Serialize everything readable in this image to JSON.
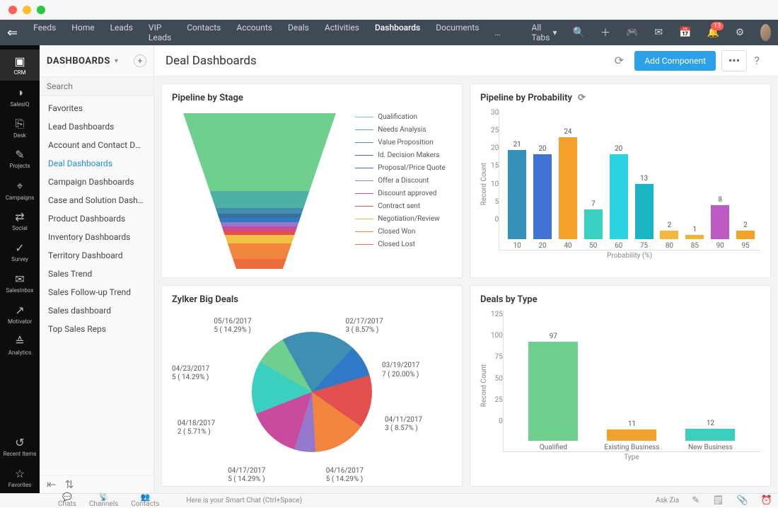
{
  "macDots": true,
  "topnav": {
    "items": [
      "Feeds",
      "Home",
      "Leads",
      "VIP Leads",
      "Contacts",
      "Accounts",
      "Deals",
      "Activities",
      "Dashboards",
      "Documents"
    ],
    "active": "Dashboards",
    "overflow": "…",
    "allTabs": "All Tabs",
    "notifBadge": "13"
  },
  "leftRail": {
    "items": [
      {
        "icon": "▣",
        "label": "CRM",
        "active": true
      },
      {
        "icon": "◑",
        "label": "SalesIQ"
      },
      {
        "icon": "⎘",
        "label": "Desk"
      },
      {
        "icon": "✎",
        "label": "Projects"
      },
      {
        "icon": "⌖",
        "label": "Campaigns"
      },
      {
        "icon": "⇄",
        "label": "Social"
      },
      {
        "icon": "✓",
        "label": "Survey"
      },
      {
        "icon": "✉",
        "label": "SalesInbox"
      },
      {
        "icon": "↗",
        "label": "Motivator"
      },
      {
        "icon": "≙",
        "label": "Analytics"
      }
    ],
    "bottom": [
      {
        "icon": "↺",
        "label": "Recent Items"
      },
      {
        "icon": "☆",
        "label": "Favorites"
      }
    ]
  },
  "sidebar": {
    "title": "DASHBOARDS",
    "searchPlaceholder": "Search",
    "items": [
      "Favorites",
      "Lead Dashboards",
      "Account and Contact Da…",
      "Deal Dashboards",
      "Campaign Dashboards",
      "Case and Solution Dash…",
      "Product Dashboards",
      "Inventory Dashboards",
      "Territory Dashboard",
      "Sales Trend",
      "Sales Follow-up Trend",
      "Sales dashboard",
      "Top Sales Reps"
    ],
    "active": "Deal Dashboards"
  },
  "mainHeader": {
    "title": "Deal Dashboards",
    "addBtn": "Add Component"
  },
  "bottomBar": {
    "chats": "Chats",
    "channels": "Channels",
    "contacts": "Contacts",
    "smartChat": "Here is your Smart Chat (Ctrl+Space)",
    "askZia": "Ask Zia"
  },
  "chart_data": [
    {
      "id": "pipeline_by_stage",
      "title": "Pipeline by Stage",
      "type": "funnel",
      "stages": [
        {
          "label": "Qualification",
          "color": "#6fcf8e"
        },
        {
          "label": "Needs Analysis",
          "color": "#4db2a5"
        },
        {
          "label": "Value Proposition",
          "color": "#3f8fb3"
        },
        {
          "label": "Id. Decision Makers",
          "color": "#3c6f99"
        },
        {
          "label": "Proposal/Price Quote",
          "color": "#2f79c6"
        },
        {
          "label": "Offer a Discount",
          "color": "#9578cb"
        },
        {
          "label": "Discount approved",
          "color": "#c94b9d"
        },
        {
          "label": "Contract sent",
          "color": "#e1504e"
        },
        {
          "label": "Negotiation/Review",
          "color": "#f4c044"
        },
        {
          "label": "Closed Won",
          "color": "#f1853e"
        },
        {
          "label": "Closed Lost",
          "color": "#ee6a3a"
        }
      ]
    },
    {
      "id": "pipeline_by_probability",
      "title": "Pipeline by Probability",
      "type": "bar",
      "ylabel": "Record Count",
      "xlabel": "Probability (%)",
      "ylim": [
        0,
        30
      ],
      "yticks": [
        0,
        5,
        10,
        15,
        20,
        25,
        30
      ],
      "categories": [
        "10",
        "20",
        "40",
        "50",
        "60",
        "75",
        "80",
        "85",
        "90",
        "95"
      ],
      "values": [
        21,
        20,
        24,
        7,
        20,
        13,
        2,
        1,
        8,
        2
      ],
      "colors": [
        "#3591b8",
        "#3f72d1",
        "#f3a12a",
        "#3bcfc0",
        "#2cd4e3",
        "#1bb5c6",
        "#f3b73f",
        "#f0b23a",
        "#bd5bc2",
        "#f3a12a"
      ]
    },
    {
      "id": "zylker_big_deals",
      "title": "Zylker Big Deals",
      "type": "pie",
      "slices": [
        {
          "label": "02/17/2017",
          "sub": "3 ( 8.57% )",
          "pct": 8.57,
          "color": "#70cf90"
        },
        {
          "label": "03/19/2017",
          "sub": "7 ( 20.00% )",
          "pct": 20.0,
          "color": "#3f8fb3"
        },
        {
          "label": "04/11/2017",
          "sub": "3 ( 8.57% )",
          "pct": 8.57,
          "color": "#2f79c6"
        },
        {
          "label": "04/16/2017",
          "sub": "5 ( 14.29% )",
          "pct": 14.29,
          "color": "#e1504e"
        },
        {
          "label": "04/17/2017",
          "sub": "5 ( 14.29% )",
          "pct": 14.29,
          "color": "#f1853e"
        },
        {
          "label": "04/18/2017",
          "sub": "2 ( 5.71% )",
          "pct": 5.71,
          "color": "#9578cb"
        },
        {
          "label": "04/23/2017",
          "sub": "5 ( 14.29% )",
          "pct": 14.29,
          "color": "#c94b9d"
        },
        {
          "label": "05/16/2017",
          "sub": "5 ( 14.29% )",
          "pct": 14.29,
          "color": "#3bcfc0"
        }
      ]
    },
    {
      "id": "deals_by_type",
      "title": "Deals by Type",
      "type": "bar",
      "ylabel": "Record Count",
      "xlabel": "Type",
      "ylim": [
        0,
        125
      ],
      "yticks": [
        0,
        25,
        50,
        75,
        100,
        125
      ],
      "categories": [
        "Qualified",
        "Existing Business",
        "New Business"
      ],
      "values": [
        97,
        11,
        12
      ],
      "colors": [
        "#6fcf8e",
        "#f3a12a",
        "#3bcfc0"
      ]
    }
  ]
}
